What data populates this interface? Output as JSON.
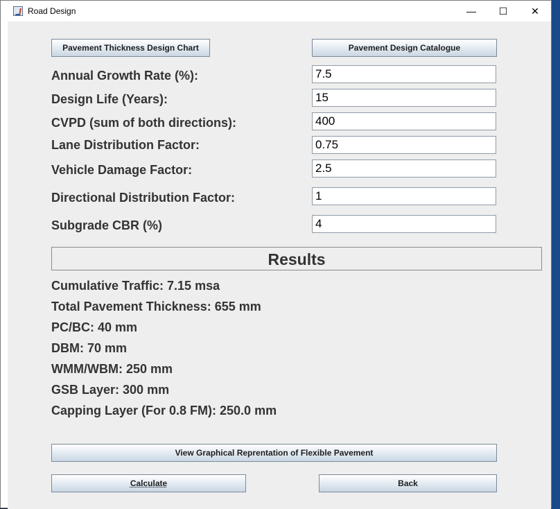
{
  "window": {
    "title": "Road Design",
    "minimize_glyph": "—",
    "maximize_glyph": "☐",
    "close_glyph": "✕"
  },
  "top_buttons": {
    "chart": "Pavement Thickness Design Chart",
    "catalogue": "Pavement Design Catalogue"
  },
  "fields": [
    {
      "label": "Annual Growth Rate (%):",
      "value": "7.5"
    },
    {
      "label": "Design Life (Years):",
      "value": "15"
    },
    {
      "label": "CVPD (sum of both directions):",
      "value": "400"
    },
    {
      "label": "Lane Distribution Factor:",
      "value": "0.75"
    },
    {
      "label": "Vehicle Damage Factor:",
      "value": "2.5"
    },
    {
      "label": "Directional Distribution Factor:",
      "value": "1"
    },
    {
      "label": "Subgrade CBR (%)",
      "value": "4"
    }
  ],
  "results": {
    "header": "Results",
    "lines": [
      "Cumulative Traffic: 7.15 msa",
      "Total Pavement Thickness: 655 mm",
      "PC/BC: 40 mm",
      "DBM: 70 mm",
      "WMM/WBM: 250 mm",
      "GSB Layer: 300 mm",
      "Capping Layer (For 0.8 FM): 250.0 mm"
    ]
  },
  "bottom_buttons": {
    "graphical": "View Graphical Reprentation of Flexible Pavement",
    "calculate": "Calculate",
    "back": "Back"
  }
}
